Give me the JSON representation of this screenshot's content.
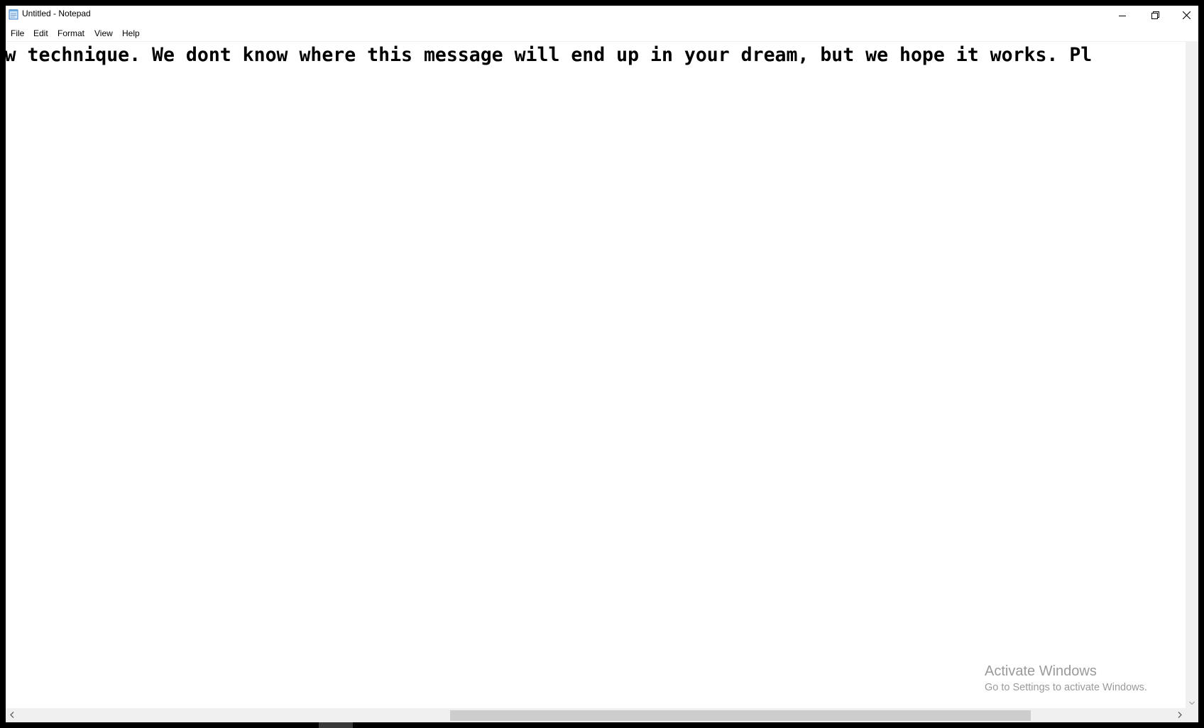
{
  "window": {
    "title": "Untitled - Notepad",
    "icons": {
      "app": "notepad-icon",
      "minimize": "minimize-icon",
      "maximize": "restore-icon",
      "close": "close-icon"
    }
  },
  "menu": {
    "items": [
      {
        "label": "File"
      },
      {
        "label": "Edit"
      },
      {
        "label": "Format"
      },
      {
        "label": "View"
      },
      {
        "label": "Help"
      }
    ]
  },
  "editor": {
    "text": "ing a new technique. We dont know where this message will end up in your dream, but we hope it works. Pl"
  },
  "scrollbars": {
    "horizontal_icons": [
      "chevron-left-icon",
      "chevron-right-icon"
    ],
    "vertical_icons": [
      "chevron-down-icon"
    ]
  },
  "watermark": {
    "title": "Activate Windows",
    "subtitle": "Go to Settings to activate Windows."
  },
  "colors": {
    "background": "#000000",
    "window": "#ffffff",
    "scroll_track": "#f0f0f0",
    "scroll_thumb": "#cdcdcd",
    "watermark": "#9a9a9a"
  }
}
